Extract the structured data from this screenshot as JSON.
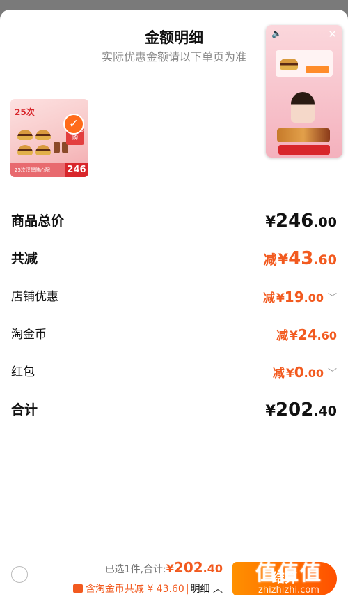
{
  "header": {
    "title": "金额明细",
    "subtitle": "实际优惠金额请以下单页为准"
  },
  "product": {
    "thumb_badge": "25次",
    "thumb_buy_label": "立即抢购",
    "thumb_price": "246",
    "thumb_footer": "25次汉堡随心配",
    "selected": true
  },
  "rows": [
    {
      "label": "商品总价",
      "prefix": "",
      "yen": "¥",
      "int": "246",
      "dec": ".00",
      "color": "black",
      "dropdown": false
    },
    {
      "label": "共减",
      "prefix": "减",
      "yen": "¥",
      "int": "43",
      "dec": ".60",
      "color": "orange",
      "dropdown": false
    },
    {
      "label": "店铺优惠",
      "prefix": "减",
      "yen": "¥",
      "int": "19",
      "dec": ".00",
      "color": "orange",
      "dropdown": true
    },
    {
      "label": "淘金币",
      "prefix": "减",
      "yen": "¥",
      "int": "24",
      "dec": ".60",
      "color": "orange",
      "dropdown": false
    },
    {
      "label": "红包",
      "prefix": "减",
      "yen": "¥",
      "int": "0",
      "dec": ".00",
      "color": "orange",
      "dropdown": true
    },
    {
      "label": "合计",
      "prefix": "",
      "yen": "¥",
      "int": "202",
      "dec": ".40",
      "color": "black",
      "dropdown": false
    }
  ],
  "bottom": {
    "selected_text": "已选1件,合计:",
    "total_yen": "¥",
    "total_int": "202",
    "total_dec": ".40",
    "coin_text": "含淘金币共减 ¥ 43.60",
    "separator": "|",
    "detail_text": "明细",
    "checkout_label": "结算"
  },
  "watermark": {
    "line1": "值值值",
    "line2": "zhizhizhi.com"
  },
  "colors": {
    "accent": "#f25a1f",
    "checkout_start": "#ff9000",
    "checkout_end": "#ff5000"
  }
}
